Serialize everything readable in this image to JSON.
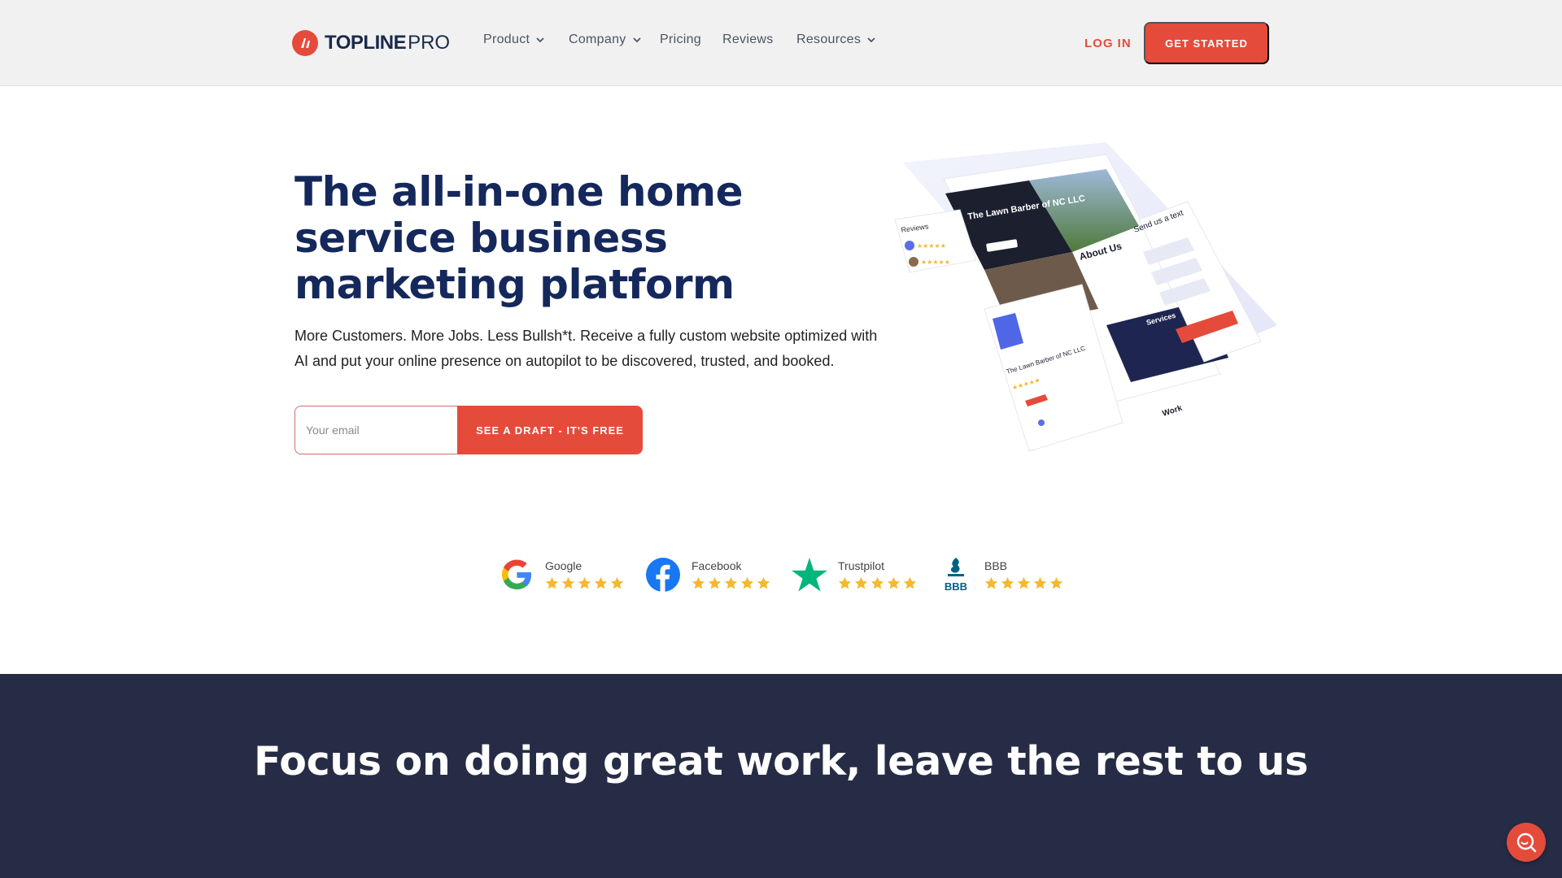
{
  "brand": {
    "name_bold": "TOPLINE",
    "name_light": "PRO",
    "accent": "#e54b3b",
    "navy": "#15285c"
  },
  "nav": {
    "items": [
      {
        "label": "Product",
        "has_dropdown": true
      },
      {
        "label": "Company",
        "has_dropdown": true
      },
      {
        "label": "Pricing",
        "has_dropdown": false
      },
      {
        "label": "Reviews",
        "has_dropdown": false
      },
      {
        "label": "Resources",
        "has_dropdown": true
      }
    ],
    "login": "LOG IN",
    "cta": "GET STARTED"
  },
  "hero": {
    "title": "The all-in-one home service business marketing platform",
    "subtitle": "More Customers. More Jobs. Less Bullsh*t. Receive a fully custom website optimized with AI and put your online presence on autopilot to be discovered, trusted, and booked.",
    "email_placeholder": "Your email",
    "email_value": "",
    "submit": "SEE A DRAFT - IT'S FREE"
  },
  "illustration": {
    "site_heading": "The Lawn Barber of NC LLC",
    "about": "About Us",
    "reviews": "Reviews",
    "send_text": "Send us a text",
    "card_title": "The Lawn Barber of NC LLC",
    "work": "Work",
    "services": "Services"
  },
  "ratings": [
    {
      "name": "Google",
      "icon": "google-icon",
      "stars": 5
    },
    {
      "name": "Facebook",
      "icon": "facebook-icon",
      "stars": 5
    },
    {
      "name": "Trustpilot",
      "icon": "trustpilot-icon",
      "stars": 5
    },
    {
      "name": "BBB",
      "icon": "bbb-icon",
      "stars": 5
    }
  ],
  "section2": {
    "title": "Focus on doing great work, leave the rest to us"
  },
  "colors": {
    "dark_section": "#272c46",
    "star": "#f5b82e"
  }
}
